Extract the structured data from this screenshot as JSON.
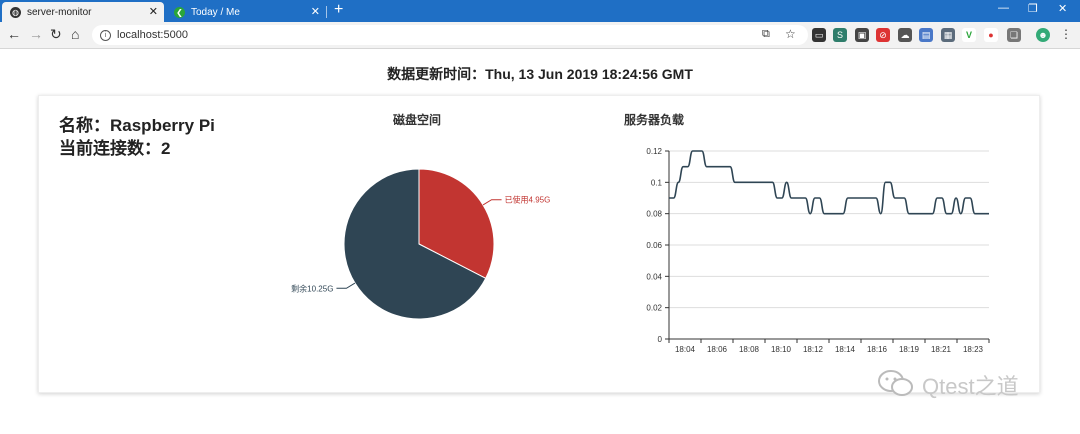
{
  "browser": {
    "tabs": [
      {
        "title": "server-monitor",
        "active": true
      },
      {
        "title": "Today / Me",
        "active": false
      }
    ],
    "address": "localhost:5000",
    "colors": {
      "tabbar": "#1f6fc5",
      "toolbar": "#f2f2f2"
    }
  },
  "page": {
    "update_time": "数据更新时间：Thu, 13 Jun 2019 18:24:56 GMT",
    "server_name": "名称：Raspberry Pi",
    "connections": "当前连接数：2"
  },
  "watermark": "Qtest之道",
  "chart_data": [
    {
      "type": "pie",
      "title": "磁盘空间",
      "labels": [
        "已使用4.95G",
        "剩余10.25G"
      ],
      "values": [
        4.95,
        10.25
      ],
      "colors": [
        "#c23531",
        "#2f4554"
      ]
    },
    {
      "type": "line",
      "title": "服务器负载",
      "x_ticks": [
        "18:04",
        "18:06",
        "18:08",
        "18:10",
        "18:12",
        "18:14",
        "18:16",
        "18:19",
        "18:21",
        "18:23"
      ],
      "y_ticks": [
        "0",
        "0.02",
        "0.04",
        "0.06",
        "0.08",
        "0.1",
        "0.12"
      ],
      "ylim": [
        0,
        0.12
      ],
      "grid": true,
      "color": "#2f4554",
      "values": [
        0.09,
        0.09,
        0.1,
        0.11,
        0.11,
        0.12,
        0.12,
        0.12,
        0.11,
        0.11,
        0.11,
        0.11,
        0.11,
        0.11,
        0.1,
        0.1,
        0.1,
        0.1,
        0.1,
        0.1,
        0.1,
        0.1,
        0.1,
        0.09,
        0.09,
        0.1,
        0.09,
        0.09,
        0.09,
        0.09,
        0.08,
        0.09,
        0.09,
        0.08,
        0.08,
        0.08,
        0.08,
        0.08,
        0.09,
        0.09,
        0.09,
        0.09,
        0.09,
        0.09,
        0.09,
        0.08,
        0.1,
        0.1,
        0.09,
        0.09,
        0.09,
        0.08,
        0.08,
        0.08,
        0.08,
        0.08,
        0.08,
        0.09,
        0.09,
        0.08,
        0.08,
        0.09,
        0.08,
        0.09,
        0.09,
        0.08,
        0.08,
        0.08,
        0.08
      ]
    }
  ]
}
